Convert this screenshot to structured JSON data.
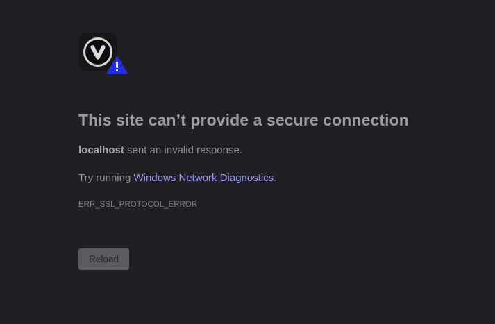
{
  "error": {
    "title": "This site can’t provide a secure connection",
    "host": "localhost",
    "description_suffix": " sent an invalid response.",
    "suggestion_prefix": "Try running ",
    "diagnostics_link": "Windows Network Diagnostics",
    "suggestion_suffix": ".",
    "error_code": "ERR_SSL_PROTOCOL_ERROR",
    "reload_label": "Reload"
  },
  "icons": {
    "logo": "vivaldi-logo-icon",
    "badge": "warning-triangle-icon"
  },
  "colors": {
    "background": "#202024",
    "link": "#9b9bff",
    "warning_badge": "#1f2de8",
    "button": "#5a5a5f"
  }
}
